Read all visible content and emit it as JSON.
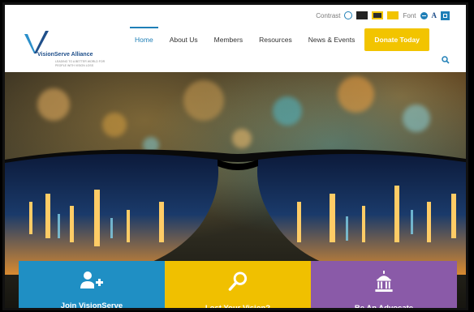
{
  "utility": {
    "contrast_label": "Contrast",
    "font_label": "Font",
    "font_a": "A"
  },
  "logo": {
    "name": "VisionServe Alliance",
    "tagline": "LEADING TO A BETTER WORLD FOR PEOPLE WITH VISION LOSS"
  },
  "nav": {
    "items": [
      "Home",
      "About Us",
      "Members",
      "Resources",
      "News & Events"
    ],
    "donate": "Donate Today"
  },
  "tiles": [
    {
      "label": "Join VisionServe",
      "icon": "add-user-icon"
    },
    {
      "label": "Lost Your Vision?",
      "icon": "magnifier-icon"
    },
    {
      "label": "Be An Advocate",
      "icon": "capitol-building-icon"
    }
  ],
  "colors": {
    "primary": "#1f7fb7",
    "accent_yellow": "#f2c400",
    "tile_blue": "#1f8fc4",
    "tile_yellow": "#f0c000",
    "tile_purple": "#8a5aa8"
  }
}
